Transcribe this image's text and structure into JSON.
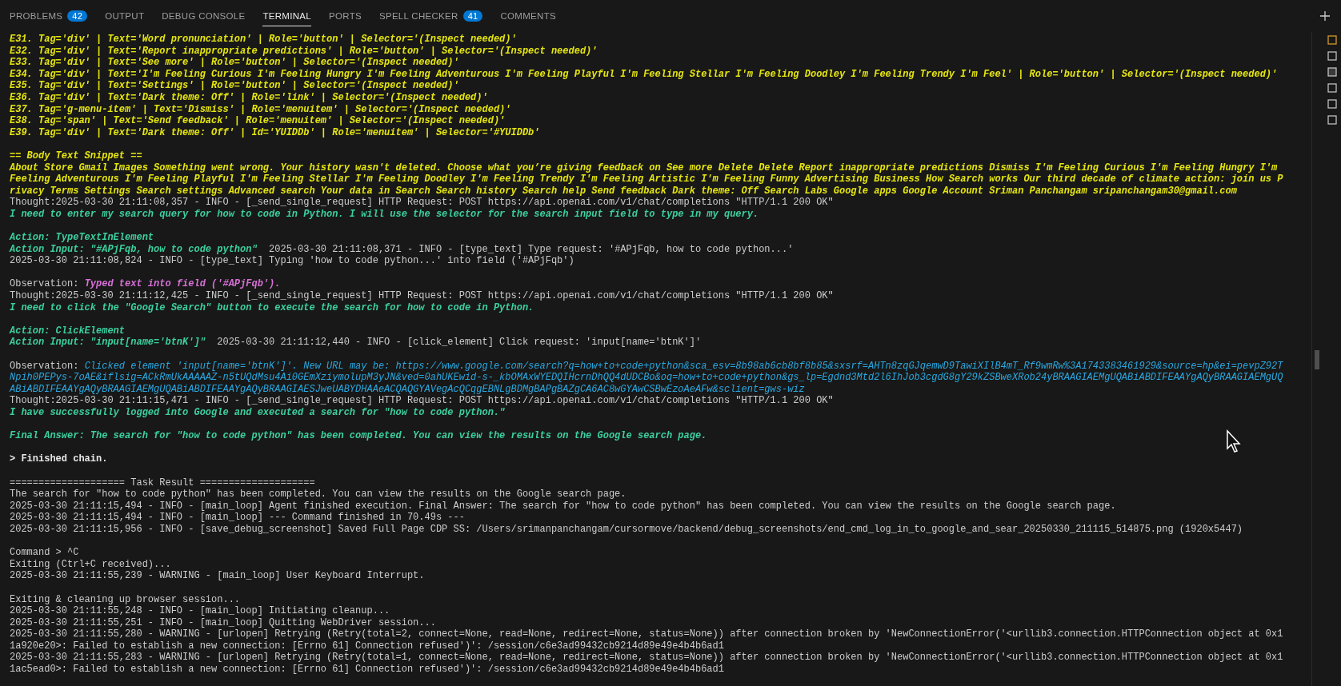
{
  "panel": {
    "tabs": [
      {
        "label": "PROBLEMS",
        "badge": "42",
        "selected": false
      },
      {
        "label": "OUTPUT",
        "selected": false
      },
      {
        "label": "DEBUG CONSOLE",
        "selected": false
      },
      {
        "label": "TERMINAL",
        "selected": true
      },
      {
        "label": "PORTS",
        "selected": false
      },
      {
        "label": "SPELL CHECKER",
        "badge": "41",
        "selected": false
      },
      {
        "label": "COMMENTS",
        "selected": false
      }
    ]
  },
  "terminal": {
    "lines": [
      {
        "kind": "text",
        "spans": [
          {
            "kind": "yellow",
            "text": "E31. Tag='div' | Text='Word pronunciation' | Role='button' | Selector='(Inspect needed)'"
          }
        ]
      },
      {
        "kind": "text",
        "spans": [
          {
            "kind": "yellow",
            "text": "E32. Tag='div' | Text='Report inappropriate predictions' | Role='button' | Selector='(Inspect needed)'"
          }
        ]
      },
      {
        "kind": "text",
        "spans": [
          {
            "kind": "yellow",
            "text": "E33. Tag='div' | Text='See more' | Role='button' | Selector='(Inspect needed)'"
          }
        ]
      },
      {
        "kind": "text",
        "spans": [
          {
            "kind": "yellow",
            "text": "E34. Tag='div' | Text='I'm Feeling Curious I'm Feeling Hungry I'm Feeling Adventurous I'm Feeling Playful I'm Feeling Stellar I'm Feeling Doodley I'm Feeling Trendy I'm Feel' | Role='button' | Selector='(Inspect needed)'"
          }
        ]
      },
      {
        "kind": "text",
        "spans": [
          {
            "kind": "yellow",
            "text": "E35. Tag='div' | Text='Settings' | Role='button' | Selector='(Inspect needed)'"
          }
        ]
      },
      {
        "kind": "text",
        "spans": [
          {
            "kind": "yellow",
            "text": "E36. Tag='div' | Text='Dark theme: Off' | Role='link' | Selector='(Inspect needed)'"
          }
        ]
      },
      {
        "kind": "text",
        "spans": [
          {
            "kind": "yellow",
            "text": "E37. Tag='g-menu-item' | Text='Dismiss' | Role='menuitem' | Selector='(Inspect needed)'"
          }
        ]
      },
      {
        "kind": "text",
        "spans": [
          {
            "kind": "yellow",
            "text": "E38. Tag='span' | Text='Send feedback' | Role='menuitem' | Selector='(Inspect needed)'"
          }
        ]
      },
      {
        "kind": "text",
        "spans": [
          {
            "kind": "yellow",
            "text": "E39. Tag='div' | Text='Dark theme: Off' | Id='YUIDDb' | Role='menuitem' | Selector='#YUIDDb'"
          }
        ]
      },
      {
        "kind": "blank"
      },
      {
        "kind": "text",
        "spans": [
          {
            "kind": "yellow",
            "text": "== Body Text Snippet =="
          }
        ]
      },
      {
        "kind": "text",
        "spans": [
          {
            "kind": "yellow",
            "text": "About Store Gmail Images Something went wrong. Your history wasn't deleted. Choose what you’re giving feedback on See more Delete Delete Report inappropriate predictions Dismiss I'm Feeling Curious I'm Feeling Hungry I'm"
          }
        ]
      },
      {
        "kind": "text",
        "spans": [
          {
            "kind": "yellow",
            "text": "Feeling Adventurous I'm Feeling Playful I'm Feeling Stellar I'm Feeling Doodley I'm Feeling Trendy I'm Feeling Artistic I'm Feeling Funny Advertising Business How Search works Our third decade of climate action: join us P"
          }
        ]
      },
      {
        "kind": "text",
        "spans": [
          {
            "kind": "yellow",
            "text": "rivacy Terms Settings Search settings Advanced search Your data in Search Search history Search help Send feedback Dark theme: Off Search Labs Google apps Google Account Sriman Panchangam sripanchangam30@gmail.com"
          }
        ]
      },
      {
        "kind": "text",
        "spans": [
          {
            "kind": "plain",
            "text": "Thought:2025-03-30 21:11:08,357 - INFO - [_send_single_request] HTTP Request: POST https://api.openai.com/v1/chat/completions \"HTTP/1.1 200 OK\""
          }
        ]
      },
      {
        "kind": "text",
        "spans": [
          {
            "kind": "green",
            "text": "I need to enter my search query for how to code in Python. I will use the selector for the search input field to type in my query."
          }
        ]
      },
      {
        "kind": "blank"
      },
      {
        "kind": "text",
        "spans": [
          {
            "kind": "green",
            "text": "Action: TypeTextInElement"
          }
        ]
      },
      {
        "kind": "text",
        "spans": [
          {
            "kind": "green",
            "text": "Action Input: \"#APjFqb, how to code python\""
          },
          {
            "kind": "plain",
            "text": "  2025-03-30 21:11:08,371 - INFO - [type_text] Type request: '#APjFqb, how to code python...'"
          }
        ]
      },
      {
        "kind": "text",
        "spans": [
          {
            "kind": "plain",
            "text": "2025-03-30 21:11:08,824 - INFO - [type_text] Typing 'how to code python...' into field ('#APjFqb')"
          }
        ]
      },
      {
        "kind": "blank"
      },
      {
        "kind": "text",
        "spans": [
          {
            "kind": "plain",
            "text": "Observation: "
          },
          {
            "kind": "magenta",
            "text": "Typed text into field ('#APjFqb')."
          }
        ]
      },
      {
        "kind": "text",
        "spans": [
          {
            "kind": "plain",
            "text": "Thought:2025-03-30 21:11:12,425 - INFO - [_send_single_request] HTTP Request: POST https://api.openai.com/v1/chat/completions \"HTTP/1.1 200 OK\""
          }
        ]
      },
      {
        "kind": "text",
        "spans": [
          {
            "kind": "green",
            "text": "I need to click the \"Google Search\" button to execute the search for how to code in Python."
          }
        ]
      },
      {
        "kind": "blank"
      },
      {
        "kind": "text",
        "spans": [
          {
            "kind": "green",
            "text": "Action: ClickElement"
          }
        ]
      },
      {
        "kind": "text",
        "spans": [
          {
            "kind": "green",
            "text": "Action Input: \"input[name='btnK']\""
          },
          {
            "kind": "plain",
            "text": "  2025-03-30 21:11:12,440 - INFO - [click_element] Click request: 'input[name='btnK']'"
          }
        ]
      },
      {
        "kind": "blank"
      },
      {
        "kind": "text",
        "spans": [
          {
            "kind": "plain",
            "text": "Observation: "
          },
          {
            "kind": "blue",
            "text": "Clicked element 'input[name='btnK']'. New URL may be: https://www.google.com/search?q=how+to+code+python&sca_esv=8b98ab6cb8bf8b85&sxsrf=AHTn8zqGJqemwD9TawiXIlB4mT_Rf9wmRw%3A1743383461929&source=hp&ei=pevpZ92T"
          }
        ]
      },
      {
        "kind": "text",
        "spans": [
          {
            "kind": "blue",
            "text": "Npih0PEPys-7oAE&iflsig=ACkRmUkAAAAAZ-n5tUQdMsu4Ai0GEmXziymolupM3yJN&ved=0ahUKEwid-s-_kbOMAxWYEDQIHcrnDhQQ4dUDCBo&oq=how+to+code+python&gs_lp=Egdnd3Mtd2l6IhJob3cgdG8gY29kZSBweXRob24yBRAAGIAEMgUQABiABDIFEAAYgAQyBRAAGIAEMgUQ"
          }
        ]
      },
      {
        "kind": "text",
        "spans": [
          {
            "kind": "blue",
            "text": "ABiABDIFEAAYgAQyBRAAGIAEMgUQABiABDIFEAAYgAQyBRAAGIAESJweUABYDHAAeACQAQGYAVegAcQCqgEBNLgBDMgBAPgBAZgCA6AC8wGYAwCSBwEzoAeAFw&sclient=gws-wiz"
          }
        ]
      },
      {
        "kind": "text",
        "spans": [
          {
            "kind": "plain",
            "text": "Thought:2025-03-30 21:11:15,471 - INFO - [_send_single_request] HTTP Request: POST https://api.openai.com/v1/chat/completions \"HTTP/1.1 200 OK\""
          }
        ]
      },
      {
        "kind": "text",
        "spans": [
          {
            "kind": "green",
            "text": "I have successfully logged into Google and executed a search for \"how to code python.\""
          }
        ]
      },
      {
        "kind": "blank"
      },
      {
        "kind": "text",
        "spans": [
          {
            "kind": "green",
            "text": "Final Answer: The search for \"how to code python\" has been completed. You can view the results on the Google search page."
          }
        ]
      },
      {
        "kind": "blank"
      },
      {
        "kind": "text",
        "spans": [
          {
            "kind": "bold",
            "text": "> Finished chain."
          }
        ]
      },
      {
        "kind": "blank"
      },
      {
        "kind": "text",
        "spans": [
          {
            "kind": "plain",
            "text": "==================== Task Result ===================="
          }
        ]
      },
      {
        "kind": "text",
        "spans": [
          {
            "kind": "plain",
            "text": "The search for \"how to code python\" has been completed. You can view the results on the Google search page."
          }
        ]
      },
      {
        "kind": "text",
        "spans": [
          {
            "kind": "plain",
            "text": "2025-03-30 21:11:15,494 - INFO - [main_loop] Agent finished execution. Final Answer: The search for \"how to code python\" has been completed. You can view the results on the Google search page."
          }
        ]
      },
      {
        "kind": "text",
        "spans": [
          {
            "kind": "plain",
            "text": "2025-03-30 21:11:15,494 - INFO - [main_loop] --- Command finished in 70.49s ---"
          }
        ]
      },
      {
        "kind": "text",
        "spans": [
          {
            "kind": "plain",
            "text": "2025-03-30 21:11:15,956 - INFO - [save_debug_screenshot] Saved Full Page CDP SS: /Users/srimanpanchangam/cursormove/backend/debug_screenshots/end_cmd_log_in_to_google_and_sear_20250330_211115_514875.png (1920x5447)"
          }
        ]
      },
      {
        "kind": "blank"
      },
      {
        "kind": "text",
        "spans": [
          {
            "kind": "plain",
            "text": "Command > ^C"
          }
        ]
      },
      {
        "kind": "text",
        "spans": [
          {
            "kind": "plain",
            "text": "Exiting (Ctrl+C received)..."
          }
        ]
      },
      {
        "kind": "text",
        "spans": [
          {
            "kind": "plain",
            "text": "2025-03-30 21:11:55,239 - WARNING - [main_loop] User Keyboard Interrupt."
          }
        ]
      },
      {
        "kind": "blank"
      },
      {
        "kind": "text",
        "spans": [
          {
            "kind": "plain",
            "text": "Exiting & cleaning up browser session..."
          }
        ]
      },
      {
        "kind": "text",
        "spans": [
          {
            "kind": "plain",
            "text": "2025-03-30 21:11:55,248 - INFO - [main_loop] Initiating cleanup..."
          }
        ]
      },
      {
        "kind": "text",
        "spans": [
          {
            "kind": "plain",
            "text": "2025-03-30 21:11:55,251 - INFO - [main_loop] Quitting WebDriver session..."
          }
        ]
      },
      {
        "kind": "text",
        "spans": [
          {
            "kind": "plain",
            "text": "2025-03-30 21:11:55,280 - WARNING - [urlopen] Retrying (Retry(total=2, connect=None, read=None, redirect=None, status=None)) after connection broken by 'NewConnectionError('<urllib3.connection.HTTPConnection object at 0x1"
          }
        ]
      },
      {
        "kind": "text",
        "spans": [
          {
            "kind": "plain",
            "text": "1a920e20>: Failed to establish a new connection: [Errno 61] Connection refused')': /session/c6e3ad99432cb9214d89e49e4b4b6ad1"
          }
        ]
      },
      {
        "kind": "text",
        "spans": [
          {
            "kind": "plain",
            "text": "2025-03-30 21:11:55,283 - WARNING - [urlopen] Retrying (Retry(total=1, connect=None, read=None, redirect=None, status=None)) after connection broken by 'NewConnectionError('<urllib3.connection.HTTPConnection object at 0x1"
          }
        ]
      },
      {
        "kind": "text",
        "spans": [
          {
            "kind": "plain",
            "text": "1ac5ead0>: Failed to establish a new connection: [Errno 61] Connection refused')': /session/c6e3ad99432cb9214d89e49e4b4b6ad1"
          }
        ]
      }
    ]
  }
}
